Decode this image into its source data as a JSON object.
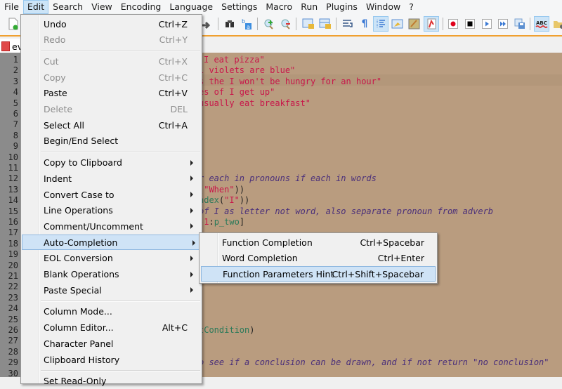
{
  "menubar": {
    "items": [
      "File",
      "Edit",
      "Search",
      "View",
      "Encoding",
      "Language",
      "Settings",
      "Macro",
      "Run",
      "Plugins",
      "Window",
      "?"
    ],
    "active_index": 1
  },
  "toolbar": {
    "icons": [
      "new-file-icon",
      "redo-icon",
      "find-icon",
      "replace-icon",
      "zoom-in-icon",
      "zoom-out-icon",
      "sync-vertical-icon",
      "sync-horizontal-icon",
      "word-wrap-icon",
      "show-all-chars-icon",
      "indent-guide-icon",
      "document-map-icon",
      "function-list-icon",
      "folder-workspace-icon",
      "record-macro-icon",
      "stop-macro-icon",
      "play-macro-icon",
      "run-macro-multiple-icon",
      "save-macro-icon",
      "spell-check-icon",
      "folder-icon"
    ],
    "toggled": [
      "indent-guide-icon",
      "folder-workspace-icon",
      "spell-check-icon"
    ]
  },
  "tab": {
    "label": "ev",
    "icon": "unsaved-file-icon"
  },
  "editor": {
    "line_numbers": [
      "1",
      "2",
      "3",
      "4",
      "5",
      "6",
      "7",
      "8",
      "9",
      "10",
      "11",
      "12",
      "13",
      "14",
      "15",
      "16",
      "17",
      "18",
      "19",
      "20",
      "21",
      "22",
      "23",
      "24",
      "25",
      "26",
      "27",
      "28",
      "29",
      "30"
    ],
    "visible_code": [
      {
        "line": 1,
        "segments": [
          {
            "t": "I eat pizza\"",
            "c": "str"
          }
        ]
      },
      {
        "line": 2,
        "segments": [
          {
            "t": "l violets are blue\"",
            "c": "str"
          }
        ]
      },
      {
        "line": 3,
        "segments": [
          {
            "t": "s the I won't be hungry for an hour\"",
            "c": "str"
          }
        ]
      },
      {
        "line": 4,
        "segments": [
          {
            "t": "es of I get up\"",
            "c": "str"
          }
        ]
      },
      {
        "line": 5,
        "segments": [
          {
            "t": "usually eat breakfast\"",
            "c": "str"
          }
        ]
      },
      {
        "line": 12,
        "segments": [
          {
            "t": "r each in pronouns if each in words",
            "c": "cmt"
          }
        ]
      },
      {
        "line": 13,
        "segments": [
          {
            "t": "(",
            "c": "pl"
          },
          {
            "t": "\"When\"",
            "c": "str"
          },
          {
            "t": "))",
            "c": "pl"
          }
        ]
      },
      {
        "line": 14,
        "segments": [
          {
            "t": "ndex",
            "c": "fn"
          },
          {
            "t": "(",
            "c": "pl"
          },
          {
            "t": "\"I\"",
            "c": "str"
          },
          {
            "t": "))",
            "c": "pl"
          }
        ]
      },
      {
        "line": 15,
        "segments": [
          {
            "t": "of I as letter not word, also separate pronoun from adverb",
            "c": "cmt"
          }
        ]
      },
      {
        "line": 16,
        "segments": [
          {
            "t": "-1",
            "c": "str"
          },
          {
            "t": ":",
            "c": "pl"
          },
          {
            "t": "p_two",
            "c": "fn"
          },
          {
            "t": "]",
            "c": "pl"
          }
        ]
      },
      {
        "line": 26,
        "segments": [
          {
            "t": "tCondition",
            "c": "fn"
          },
          {
            "t": ")",
            "c": "pl"
          }
        ]
      },
      {
        "line": 29,
        "segments": [
          {
            "t": "o see if a conclusion can be drawn, and if not return \"no conclusion\"",
            "c": "cmt"
          }
        ]
      }
    ]
  },
  "edit_menu": {
    "items": [
      {
        "label": "Undo",
        "shortcut": "Ctrl+Z",
        "disabled": false
      },
      {
        "label": "Redo",
        "shortcut": "Ctrl+Y",
        "disabled": true
      },
      {
        "sep": true
      },
      {
        "label": "Cut",
        "shortcut": "Ctrl+X",
        "disabled": true
      },
      {
        "label": "Copy",
        "shortcut": "Ctrl+C",
        "disabled": true
      },
      {
        "label": "Paste",
        "shortcut": "Ctrl+V",
        "disabled": false
      },
      {
        "label": "Delete",
        "shortcut": "DEL",
        "disabled": true
      },
      {
        "label": "Select All",
        "shortcut": "Ctrl+A",
        "disabled": false
      },
      {
        "label": "Begin/End Select",
        "shortcut": "",
        "disabled": false
      },
      {
        "sep": true
      },
      {
        "label": "Copy to Clipboard",
        "submenu": true
      },
      {
        "label": "Indent",
        "submenu": true
      },
      {
        "label": "Convert Case to",
        "submenu": true
      },
      {
        "label": "Line Operations",
        "submenu": true
      },
      {
        "label": "Comment/Uncomment",
        "submenu": true
      },
      {
        "label": "Auto-Completion",
        "submenu": true,
        "highlighted": true
      },
      {
        "label": "EOL Conversion",
        "submenu": true
      },
      {
        "label": "Blank Operations",
        "submenu": true
      },
      {
        "label": "Paste Special",
        "submenu": true
      },
      {
        "sep": true
      },
      {
        "label": "Column Mode...",
        "shortcut": ""
      },
      {
        "label": "Column Editor...",
        "shortcut": "Alt+C"
      },
      {
        "label": "Character Panel",
        "shortcut": ""
      },
      {
        "label": "Clipboard History",
        "shortcut": ""
      },
      {
        "sep": true
      },
      {
        "label": "Set Read-Only",
        "shortcut": ""
      }
    ]
  },
  "autocompletion_submenu": {
    "items": [
      {
        "label": "Function Completion",
        "shortcut": "Ctrl+Spacebar"
      },
      {
        "label": "Word Completion",
        "shortcut": "Ctrl+Enter"
      },
      {
        "label": "Function Parameters Hint",
        "shortcut": "Ctrl+Shift+Spacebar",
        "highlighted": true
      }
    ]
  }
}
